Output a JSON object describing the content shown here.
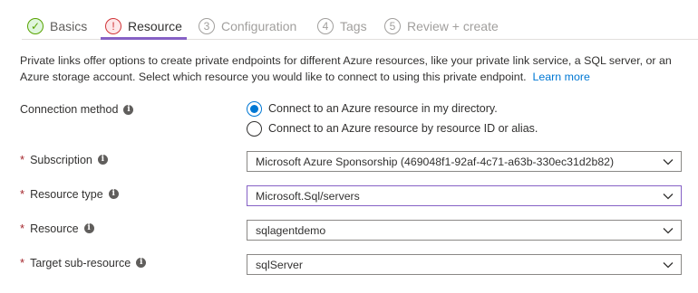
{
  "tabs": [
    {
      "step": "✓",
      "label": "Basics",
      "state": "done"
    },
    {
      "step": "!",
      "label": "Resource",
      "state": "current"
    },
    {
      "step": "3",
      "label": "Configuration",
      "state": "todo"
    },
    {
      "step": "4",
      "label": "Tags",
      "state": "todo"
    },
    {
      "step": "5",
      "label": "Review + create",
      "state": "todo"
    }
  ],
  "intro": {
    "text": "Private links offer options to create private endpoints for different Azure resources, like your private link service, a SQL server, or an Azure storage account. Select which resource you would like to connect to using this private endpoint.",
    "link": "Learn more"
  },
  "form": {
    "connection_method": {
      "label": "Connection method",
      "options": [
        {
          "label": "Connect to an Azure resource in my directory.",
          "selected": true
        },
        {
          "label": "Connect to an Azure resource by resource ID or alias.",
          "selected": false
        }
      ]
    },
    "subscription": {
      "required": "*",
      "label": "Subscription",
      "value": "Microsoft Azure Sponsorship (469048f1-92af-4c71-a63b-330ec31d2b82)"
    },
    "resource_type": {
      "required": "*",
      "label": "Resource type",
      "value": "Microsoft.Sql/servers"
    },
    "resource": {
      "required": "*",
      "label": "Resource",
      "value": "sqlagentdemo"
    },
    "target_sub_resource": {
      "required": "*",
      "label": "Target sub-resource",
      "value": "sqlServer"
    }
  },
  "icons": {
    "info": "info-icon",
    "chevron": "chevron-down-icon",
    "radio": "radio-button"
  },
  "colors": {
    "accent": "#8661c5",
    "link": "#0078d4",
    "success": "#57a300",
    "error": "#d13438",
    "required": "#a4262c"
  }
}
